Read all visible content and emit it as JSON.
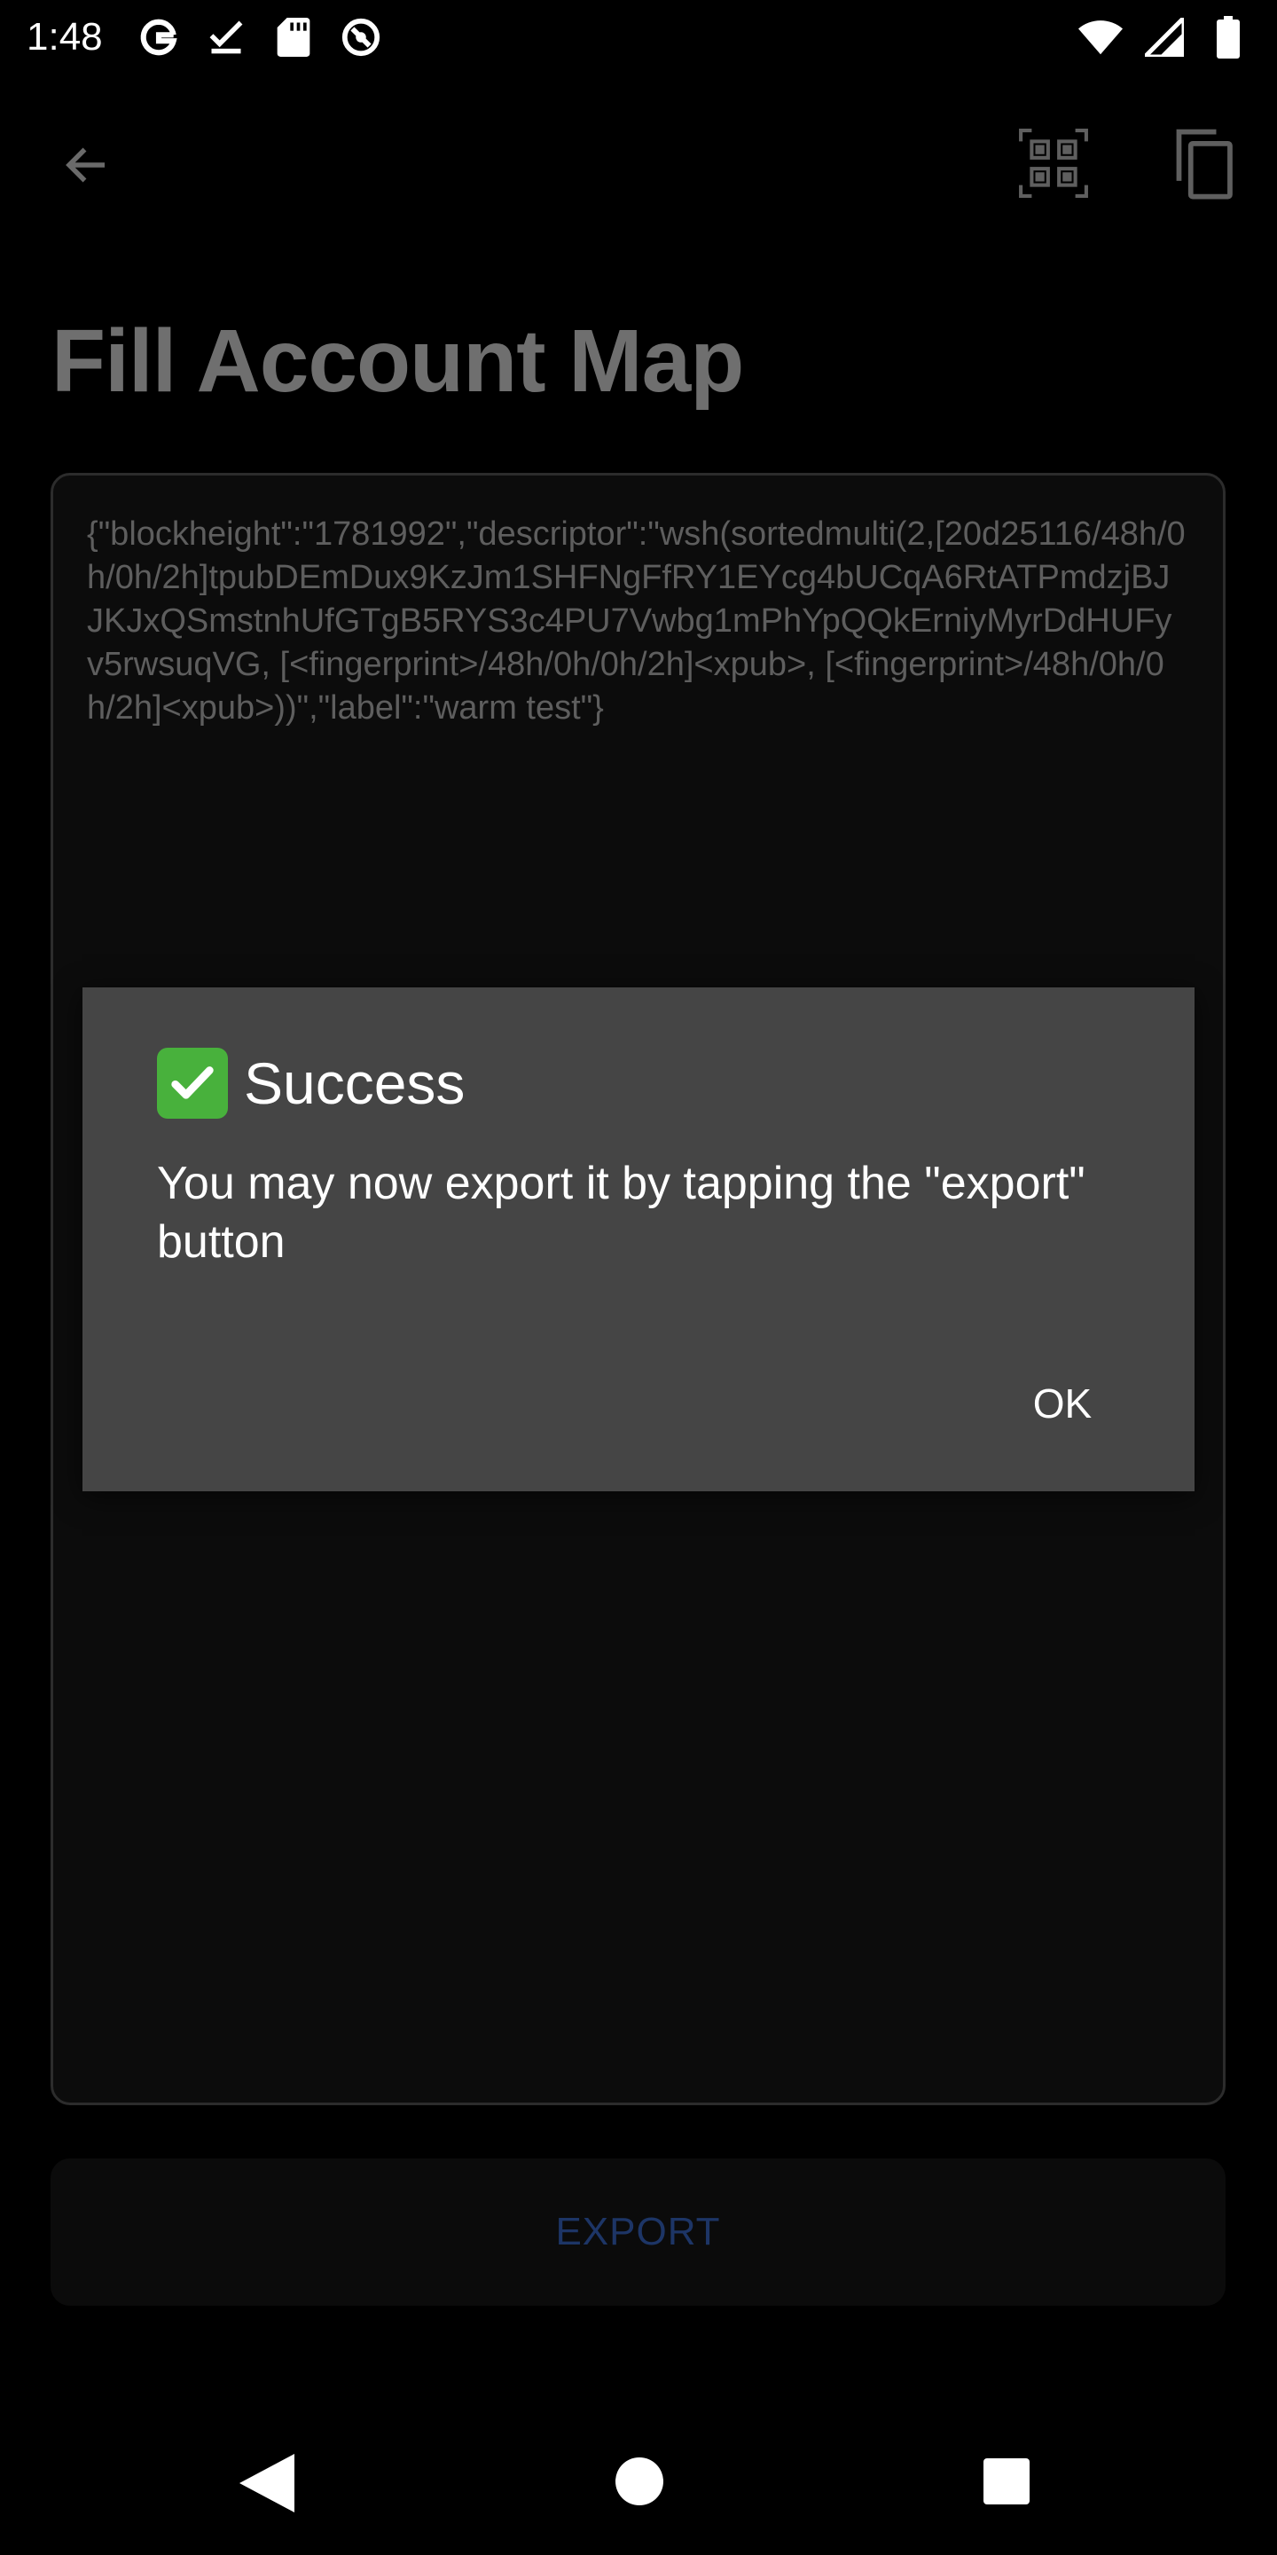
{
  "status_bar": {
    "time": "1:48",
    "left_icons": [
      "google-icon",
      "download-done-icon",
      "sd-card-icon",
      "no-disturb-icon"
    ],
    "right_icons": [
      "wifi-icon",
      "cell-signal-icon",
      "battery-icon"
    ]
  },
  "app_bar": {
    "back_icon": "arrow-back-icon",
    "actions": [
      "qr-code-icon",
      "copy-icon"
    ]
  },
  "page": {
    "title": "Fill Account Map"
  },
  "text_area": {
    "value": "{\"blockheight\":\"1781992\",\"descriptor\":\"wsh(sortedmulti(2,[20d25116/48h/0h/0h/2h]tpubDEmDux9KzJm1SHFNgFfRY1EYcg4bUCqA6RtATPmdzjBJJKJxQSmstnhUfGTgB5RYS3c4PU7Vwbg1mPhYpQQkErniyMyrDdHUFyv5rwsuqVG, [<fingerprint>/48h/0h/0h/2h]<xpub>, [<fingerprint>/48h/0h/0h/2h]<xpub>))\",\"label\":\"warm test\"}"
  },
  "export_button": {
    "label": "EXPORT"
  },
  "dialog": {
    "title": "Success",
    "title_icon": "check-mark-icon",
    "message": "You may now export it by tapping the \"export\" button",
    "ok_label": "OK"
  },
  "nav_bar": {
    "buttons": [
      "nav-back-icon",
      "nav-home-icon",
      "nav-recents-icon"
    ]
  },
  "colors": {
    "background": "#000000",
    "dialog": "#454545",
    "title": "#6f6f6f",
    "export_text": "#1d3566",
    "success_green": "#48b13c"
  }
}
